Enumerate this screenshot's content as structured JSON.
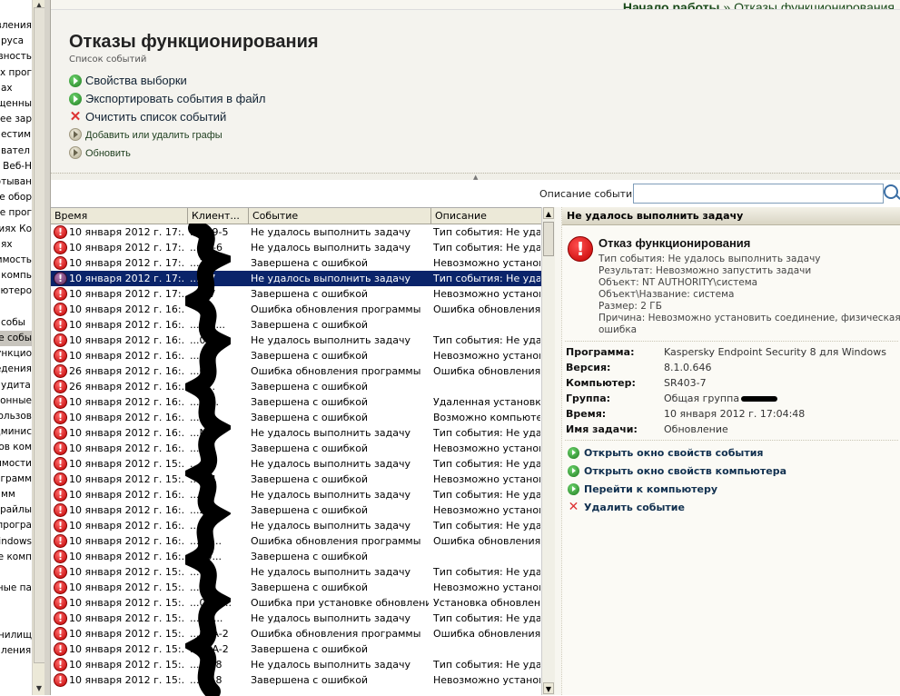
{
  "tree": {
    "items": [
      "вления",
      "руса",
      "вность",
      "ях прог",
      "ах",
      "щенны",
      "лее зар",
      "естим",
      "вател",
      "е Веб-Н",
      "отыван",
      "ре обор",
      "ре прог",
      "иях Ко",
      "ях",
      "имость",
      "я компь",
      "ьютеро",
      "",
      "собы",
      "рие собы",
      "ункцио",
      "едения",
      "удита",
      "онные",
      "ользов",
      "дминис",
      "ов ком",
      "имости",
      "грамм",
      "мм",
      "райлы",
      "програ",
      "Windows",
      "е комп",
      "",
      "ные па",
      "",
      "",
      "нилищ",
      "ления"
    ],
    "selected_index": 20
  },
  "breadcrumb": {
    "home": "Начало работы",
    "separator": " » ",
    "current": "Отказы функционирования"
  },
  "page": {
    "title": "Отказы функционирования",
    "subtitle": "Список событий"
  },
  "actions": [
    {
      "label": "Свойства выборки",
      "icon": "green-arrow-icon"
    },
    {
      "label": "Экспортировать события в файл",
      "icon": "green-arrow-icon"
    },
    {
      "label": "Очистить список событий",
      "icon": "red-x-icon"
    },
    {
      "label": "Добавить или удалить графы",
      "icon": "gray-arrow-icon"
    },
    {
      "label": "Обновить",
      "icon": "gray-arrow-icon"
    }
  ],
  "filter": {
    "label": "Описание события:",
    "value": ""
  },
  "columns": [
    "Время",
    "Клиент...",
    "Событие",
    "Описание"
  ],
  "rows": [
    {
      "time": "10 января 2012 г. 17:...",
      "client": "...209-5",
      "event": "Не удалось выполнить задачу",
      "desc": "Тип события: Не удало"
    },
    {
      "time": "10 января 2012 г. 17:...",
      "client": "...3B-6",
      "event": "Не удалось выполнить задачу",
      "desc": "Тип события: Не удало"
    },
    {
      "time": "10 января 2012 г. 17:...",
      "client": "...3B-6",
      "event": "Завершена с ошибкой",
      "desc": "Невозможно установит"
    },
    {
      "time": "10 января 2012 г. 17:...",
      "client": "...3-7",
      "event": "Не удалось выполнить задачу",
      "desc": "Тип события: Не удало"
    },
    {
      "time": "10 января 2012 г. 17:...",
      "client": "...3-7",
      "event": "Завершена с ошибкой",
      "desc": "Невозможно установит"
    },
    {
      "time": "10 января 2012 г. 16:...",
      "client": "",
      "event": "Ошибка обновления программы",
      "desc": "Ошибка обновления: Н"
    },
    {
      "time": "10 января 2012 г. 16:...",
      "client": "...06-...",
      "event": "Завершена с ошибкой",
      "desc": ""
    },
    {
      "time": "10 января 2012 г. 16:...",
      "client": "...01",
      "event": "Не удалось выполнить задачу",
      "desc": "Тип события: Не удало"
    },
    {
      "time": "10 января 2012 г. 16:...",
      "client": "...01",
      "event": "Завершена с ошибкой",
      "desc": "Невозможно установит"
    },
    {
      "time": "26 января 2012 г. 16:...",
      "client": "...0...",
      "event": "Ошибка обновления программы",
      "desc": "Ошибка обновления: Н"
    },
    {
      "time": "26 января 2012 г. 16:...",
      "client": "...0...",
      "event": "Завершена с ошибкой",
      "desc": ""
    },
    {
      "time": "10 января 2012 г. 16:...",
      "client": "...-1...",
      "event": "Завершена с ошибкой",
      "desc": "Удаленная установка н"
    },
    {
      "time": "10 января 2012 г. 16:...",
      "client": "...0...",
      "event": "Завершена с ошибкой",
      "desc": "Возможно компьютер о"
    },
    {
      "time": "10 января 2012 г. 16:...",
      "client": "...N",
      "event": "Не удалось выполнить задачу",
      "desc": "Тип события: Не удало"
    },
    {
      "time": "10 января 2012 г. 16:...",
      "client": "...N",
      "event": "Завершена с ошибкой",
      "desc": "Невозможно установит"
    },
    {
      "time": "10 января 2012 г. 15:...",
      "client": "...G-1",
      "event": "Не удалось выполнить задачу",
      "desc": "Тип события: Не удало"
    },
    {
      "time": "10 января 2012 г. 15:...",
      "client": "...G-1",
      "event": "Завершена с ошибкой",
      "desc": "Невозможно установит"
    },
    {
      "time": "10 января 2012 г. 16:...",
      "client": "...2",
      "event": "Не удалось выполнить задачу",
      "desc": "Тип события: Не удало"
    },
    {
      "time": "10 января 2012 г. 16:...",
      "client": "...2",
      "event": "Завершена с ошибкой",
      "desc": "Невозможно установит"
    },
    {
      "time": "10 января 2012 г. 16:...",
      "client": "...N",
      "event": "Не удалось выполнить задачу",
      "desc": "Тип события: Не удало"
    },
    {
      "time": "10 января 2012 г. 16:...",
      "client": "...20...",
      "event": "Ошибка обновления программы",
      "desc": "Ошибка обновления: Н"
    },
    {
      "time": "10 января 2012 г. 16:...",
      "client": "...20...",
      "event": "Завершена с ошибкой",
      "desc": ""
    },
    {
      "time": "10 января 2012 г. 15:...",
      "client": "...ON",
      "event": "Не удалось выполнить задачу",
      "desc": "Тип события: Не удало"
    },
    {
      "time": "10 января 2012 г. 15:...",
      "client": "...ON",
      "event": "Завершена с ошибкой",
      "desc": "Невозможно установит"
    },
    {
      "time": "10 января 2012 г. 15:...",
      "client": "...02-1...",
      "event": "Ошибка при установке обновлени...",
      "desc": "Установка обновлений"
    },
    {
      "time": "10 января 2012 г. 15:...",
      "client": "...IN-...",
      "event": "Не удалось выполнить задачу",
      "desc": "Тип события: Не удало"
    },
    {
      "time": "10 января 2012 г. 15:...",
      "client": "...02A-2",
      "event": "Ошибка обновления программы",
      "desc": "Ошибка обновления: Н"
    },
    {
      "time": "10 января 2012 г. 15:...",
      "client": "...02A-2",
      "event": "Завершена с ошибкой",
      "desc": ""
    },
    {
      "time": "10 января 2012 г. 15:...",
      "client": "...12-8",
      "event": "Не удалось выполнить задачу",
      "desc": "Тип события: Не удало"
    },
    {
      "time": "10 января 2012 г. 15:...",
      "client": "...12-8",
      "event": "Завершена с ошибкой",
      "desc": "Невозможно установит"
    }
  ],
  "selected_row": 3,
  "detail": {
    "header": "Не удалось выполнить задачу",
    "title": "Отказ функционирования",
    "lines": [
      "Тип события: Не удалось выполнить задачу",
      "Результат: Невозможно запустить задачи",
      "Объект: NT AUTHORITY\\система",
      "Объект\\Название: система",
      "Размер: 2 ГБ",
      "Причина: Невозможно установить соединение, физическая",
      "ошибка"
    ],
    "props": [
      {
        "key": "Программа:",
        "value": "Kaspersky Endpoint Security 8 для Windows"
      },
      {
        "key": "Версия:",
        "value": "8.1.0.646"
      },
      {
        "key": "Компьютер:",
        "value": "SR403-7"
      },
      {
        "key": "Группа:",
        "value": "Общая группа"
      },
      {
        "key": "Время:",
        "value": "10 января 2012 г. 17:04:48"
      },
      {
        "key": "Имя задачи:",
        "value": "Обновление"
      }
    ],
    "actions": [
      {
        "label": "Открыть окно свойств события",
        "icon": "green-arrow-icon"
      },
      {
        "label": "Открыть окно свойств компьютера",
        "icon": "green-arrow-icon"
      },
      {
        "label": "Перейти к компьютеру",
        "icon": "green-arrow-icon"
      },
      {
        "label": "Удалить событие",
        "icon": "red-x-icon"
      }
    ]
  }
}
